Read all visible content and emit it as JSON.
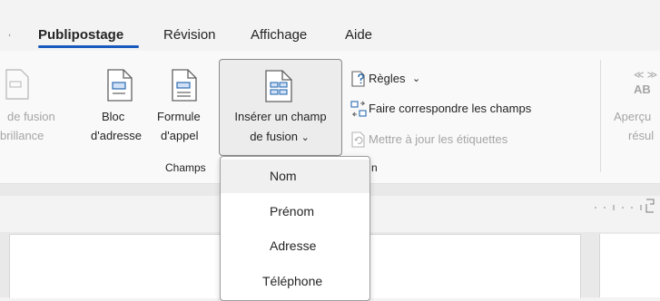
{
  "tabs": [
    {
      "label": "Publipostage",
      "active": true
    },
    {
      "label": "Révision",
      "active": false
    },
    {
      "label": "Affichage",
      "active": false
    },
    {
      "label": "Aide",
      "active": false
    }
  ],
  "ribbon": {
    "buttons": [
      {
        "line1": "de fusion",
        "line2": "brillance",
        "enabled": false
      },
      {
        "line1": "Bloc",
        "line2": "d'adresse",
        "enabled": true
      },
      {
        "line1": "Formule",
        "line2": "d'appel",
        "enabled": true
      },
      {
        "line1": "Insérer un champ",
        "line2": "de fusion",
        "dropdown_glyph": "⌄",
        "enabled": true,
        "pressed": true
      }
    ],
    "rules": [
      {
        "label": "Règles",
        "dropdown_glyph": "⌄",
        "icon": "rules-icon",
        "enabled": true
      },
      {
        "label": "Faire correspondre les champs",
        "icon": "match-fields-icon",
        "enabled": true
      },
      {
        "label": "Mettre à jour les étiquettes",
        "icon": "update-labels-icon",
        "enabled": false
      }
    ],
    "group_label_left": "Champs",
    "group_label_right": "n",
    "preview": {
      "top": "≪ ≫",
      "abbr": "AB",
      "line1": "Aperçu",
      "line2": "résul",
      "enabled": false
    }
  },
  "dropdown": {
    "items": [
      {
        "label": "Nom",
        "highlighted": true
      },
      {
        "label": "Prénom",
        "highlighted": false
      },
      {
        "label": "Adresse",
        "highlighted": false
      },
      {
        "label": "Téléphone",
        "highlighted": false
      }
    ]
  },
  "colors": {
    "accent": "#185abd",
    "ribbon_bg": "#f9f9f9",
    "pressed_bg": "#ececec",
    "disabled_text": "#a5a5a5",
    "icon_blue": "#2b6cb0"
  }
}
